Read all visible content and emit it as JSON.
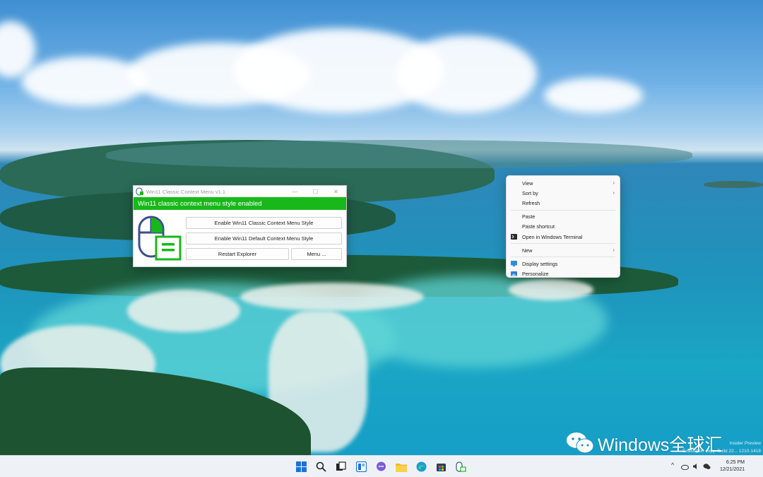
{
  "app_window": {
    "title": "Win11 Classic Context Menu v1.1",
    "status": "Win11 classic context menu style enabled",
    "status_color": "#18b81a",
    "buttons": {
      "classic": "Enable Win11 Classic Context Menu Style",
      "default": "Enable Win11 Default Context Menu Style",
      "restart": "Restart Explorer",
      "menu": "Menu ..."
    },
    "controls": {
      "minimize": "—",
      "maximize": "☐",
      "close": "✕"
    }
  },
  "context_menu": {
    "groups": [
      [
        {
          "label": "View",
          "submenu": true
        },
        {
          "label": "Sort by",
          "submenu": true
        },
        {
          "label": "Refresh",
          "submenu": false
        }
      ],
      [
        {
          "label": "Paste",
          "submenu": false
        },
        {
          "label": "Paste shortcut",
          "submenu": false
        },
        {
          "label": "Open in Windows Terminal",
          "submenu": false,
          "icon": "terminal-icon"
        }
      ],
      [
        {
          "label": "New",
          "submenu": true
        }
      ],
      [
        {
          "label": "Display settings",
          "submenu": false,
          "icon": "display-icon"
        },
        {
          "label": "Personalize",
          "submenu": false,
          "icon": "personalize-icon"
        }
      ]
    ],
    "submenu_glyph": "›"
  },
  "taskbar": {
    "icons": [
      "start-icon",
      "search-icon",
      "task-view-icon",
      "widgets-icon",
      "chat-icon",
      "file-explorer-icon",
      "edge-icon",
      "store-icon",
      "classic-menu-app-icon"
    ],
    "tray_chevron": "^",
    "clock_time": "6:25 PM",
    "clock_date": "12/21/2021"
  },
  "watermark": {
    "text": "Windows全球汇",
    "eval_line1": "Insider Preview",
    "eval_line2": "Evaluation copy. Build 22... 1210-1418"
  }
}
